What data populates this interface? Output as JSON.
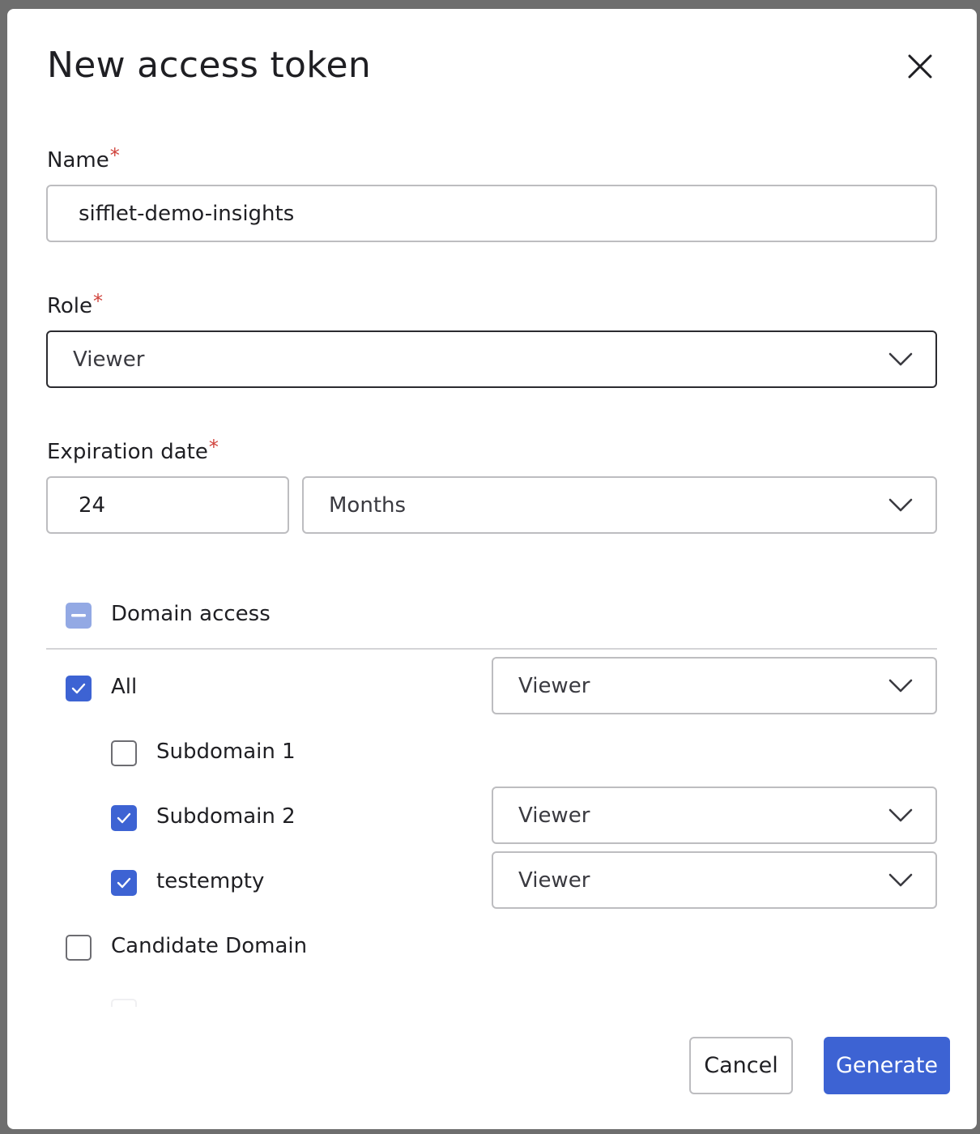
{
  "dialog": {
    "title": "New access token",
    "close_icon": "close-icon"
  },
  "name_field": {
    "label": "Name",
    "required_mark": "*",
    "value": "sifflet-demo-insights"
  },
  "role_field": {
    "label": "Role",
    "required_mark": "*",
    "selected": "Viewer"
  },
  "expiration_field": {
    "label": "Expiration date",
    "required_mark": "*",
    "amount": "24",
    "unit": "Months"
  },
  "domain_access": {
    "label": "Domain access",
    "state": "partial",
    "items": [
      {
        "label": "All",
        "checked": true,
        "role": "Viewer"
      },
      {
        "label": "Subdomain 1",
        "checked": false
      },
      {
        "label": "Subdomain 2",
        "checked": true,
        "role": "Viewer"
      },
      {
        "label": "testempty",
        "checked": true,
        "role": "Viewer"
      },
      {
        "label": "Candidate Domain",
        "checked": false
      }
    ]
  },
  "actions": {
    "cancel_label": "Cancel",
    "generate_label": "Generate"
  },
  "colors": {
    "primary": "#3d63d3",
    "required": "#d0433c",
    "partial_checkbox": "#93a9e4"
  }
}
